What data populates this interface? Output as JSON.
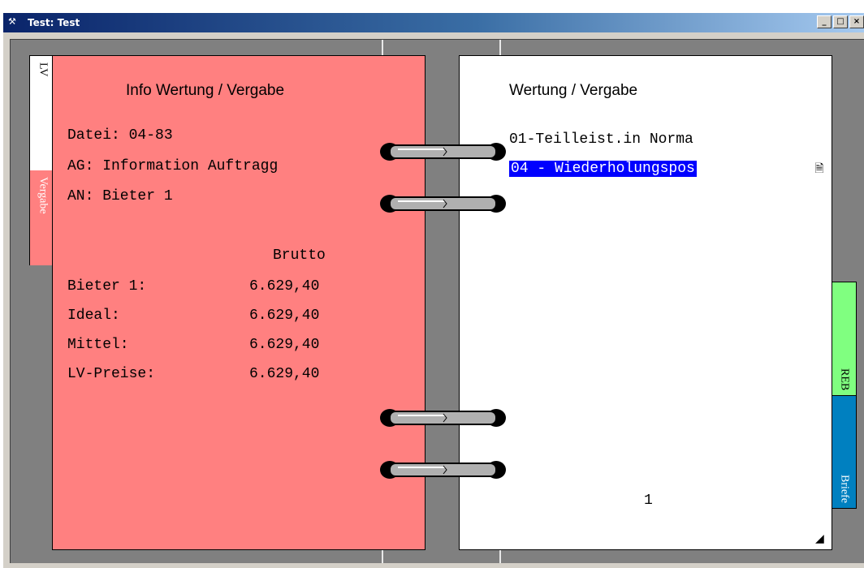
{
  "window": {
    "icon": "app-icon",
    "title": "Test: Test",
    "buttons": [
      {
        "name": "minimize",
        "label": "_"
      },
      {
        "name": "maximize",
        "label": "□"
      },
      {
        "name": "close",
        "label": "×"
      }
    ]
  },
  "left_page": {
    "title": "Info Wertung / Vergabe",
    "datei": "Datei: 04-83",
    "ag": "AG: Information Auftragg",
    "an": "AN: Bieter 1",
    "column_header": "Brutto",
    "rows": [
      {
        "label": "Bieter 1:",
        "value": "6.629,40"
      },
      {
        "label": "Ideal:",
        "value": "6.629,40"
      },
      {
        "label": "Mittel:",
        "value": "6.629,40"
      },
      {
        "label": "LV-Preise:",
        "value": "6.629,40"
      }
    ],
    "tabs": {
      "lv": "LV",
      "vergabe": "Vergabe"
    }
  },
  "right_page": {
    "title": "Wertung / Vergabe",
    "items": [
      {
        "label": "01-Teilleist.in Norma",
        "selected": false
      },
      {
        "label": "04 - Wiederholungspos",
        "selected": true
      }
    ],
    "page_number": "1",
    "tabs": {
      "reb": "REB",
      "briefe": "Briefe"
    }
  },
  "colors": {
    "left_page": "#ff8080",
    "selection": "#0000ff",
    "reb_tab": "#80ff80",
    "briefe_tab": "#0080c0",
    "title_bar": "#0a246a"
  }
}
